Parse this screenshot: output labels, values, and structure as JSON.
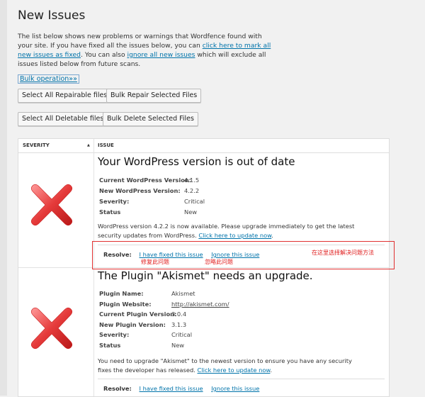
{
  "page": {
    "title": "New Issues",
    "intro": {
      "text1": "The list below shows new problems or warnings that Wordfence found with your site. If you have fixed all the issues below, you can ",
      "link1": "click here to mark all new issues as fixed",
      "text2": ". You can also ",
      "link2": "ignore all new issues",
      "text3": " which will exclude all issues listed below from future scans."
    },
    "bulk_operation": "Bulk operation»»"
  },
  "buttons": {
    "select_repairable": "Select All Repairable files",
    "bulk_repair": "Bulk Repair Selected Files",
    "select_deletable": "Select All Deletable files",
    "bulk_delete": "Bulk Delete Selected Files"
  },
  "table": {
    "col_severity": "SEVERITY",
    "sort_arrow": "▲",
    "col_issue": "ISSUE"
  },
  "issues": [
    {
      "title": "Your WordPress version is out of date",
      "fields": [
        {
          "k": "Current WordPress Version:",
          "v": "4.1.5"
        },
        {
          "k": "New WordPress Version:",
          "v": "4.2.2"
        },
        {
          "k": "Severity:",
          "v": "Critical"
        },
        {
          "k": "Status",
          "v": "New"
        }
      ],
      "desc": "WordPress version 4.2.2 is now available. Please upgrade immediately to get the latest security updates from WordPress. ",
      "desc_link": "Click here to update now",
      "desc_end": ".",
      "resolve_label": "Resolve:",
      "fixed_link": "I have fixed this issue",
      "ignore_link": "Ignore this issue",
      "icon": "red-x-icon"
    },
    {
      "title": "The Plugin \"Akismet\" needs an upgrade.",
      "fields": [
        {
          "k": "Plugin Name:",
          "v": "Akismet"
        },
        {
          "k": "Plugin Website:",
          "v": "http://akismet.com/"
        },
        {
          "k": "Current Plugin Version:",
          "v": "3.0.4"
        },
        {
          "k": "New Plugin Version:",
          "v": "3.1.3"
        },
        {
          "k": "Severity:",
          "v": "Critical"
        },
        {
          "k": "Status",
          "v": "New"
        }
      ],
      "desc": "You need to upgrade \"Akismet\" to the newest version to ensure you have any security fixes the developer has released. ",
      "desc_link": "Click here to update now",
      "desc_end": ".",
      "resolve_label": "Resolve:",
      "fixed_link": "I have fixed this issue",
      "ignore_link": "Ignore this issue",
      "icon": "red-x-icon"
    }
  ],
  "annotations": {
    "fixed_cn": "修复此问题",
    "ignore_cn": "忽略此问题",
    "choose_cn": "在这里选择解决问题方法",
    "highlight_color": "#e02020"
  }
}
